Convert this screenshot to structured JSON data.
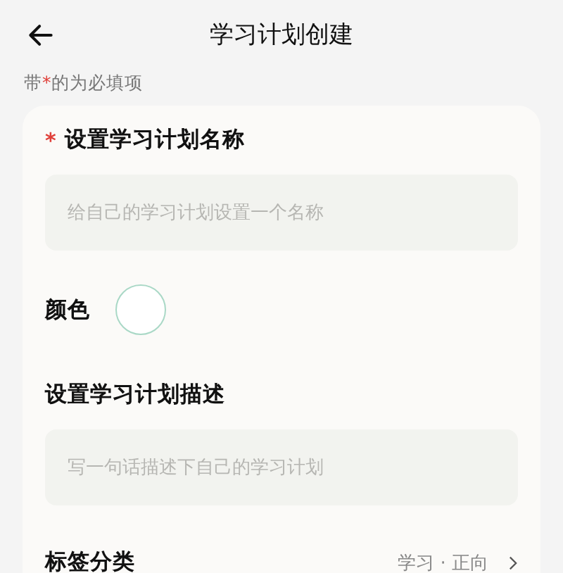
{
  "header": {
    "title": "学习计划创建"
  },
  "note": {
    "before": "带",
    "mark": "*",
    "after": "的为必填项"
  },
  "form": [
    {
      "kind": "text",
      "required_mark": "*",
      "label": "设置学习计划名称",
      "placeholder": "给自己的学习计划设置一个名称"
    },
    {
      "kind": "color",
      "label": "颜色"
    },
    {
      "kind": "text",
      "label": "设置学习计划描述",
      "placeholder": "写一句话描述下自己的学习计划"
    },
    {
      "kind": "select",
      "label": "标签分类",
      "value": "学习 · 正向"
    }
  ]
}
